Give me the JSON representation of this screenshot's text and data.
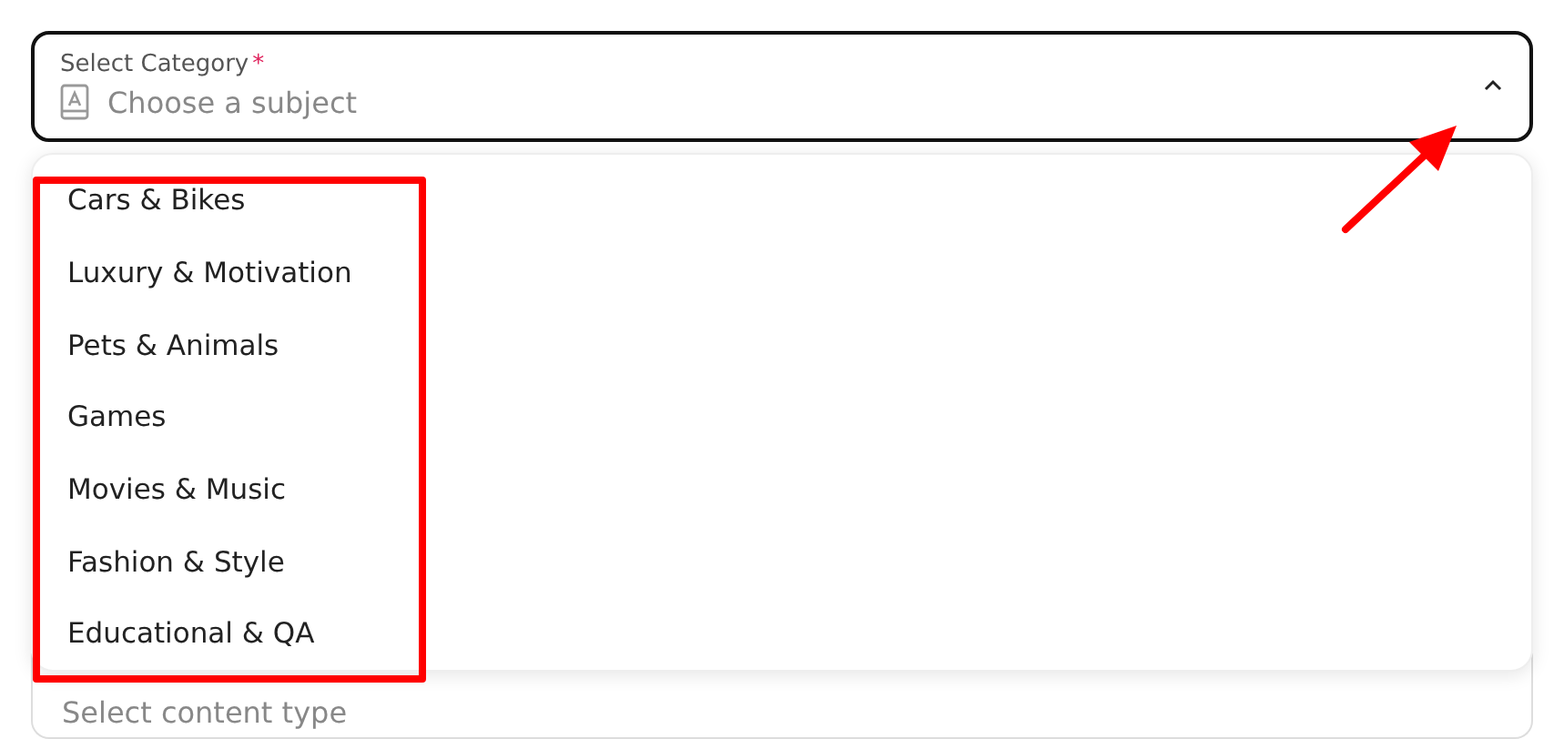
{
  "category_field": {
    "label": "Select Category",
    "required_mark": "*",
    "placeholder": "Choose a subject",
    "expanded": true
  },
  "options": [
    {
      "label": "Cars & Bikes"
    },
    {
      "label": "Luxury & Motivation"
    },
    {
      "label": "Pets & Animals"
    },
    {
      "label": "Games"
    },
    {
      "label": "Movies & Music"
    },
    {
      "label": "Fashion & Style"
    },
    {
      "label": "Educational & QA"
    }
  ],
  "content_type_field": {
    "placeholder": "Select content type"
  }
}
